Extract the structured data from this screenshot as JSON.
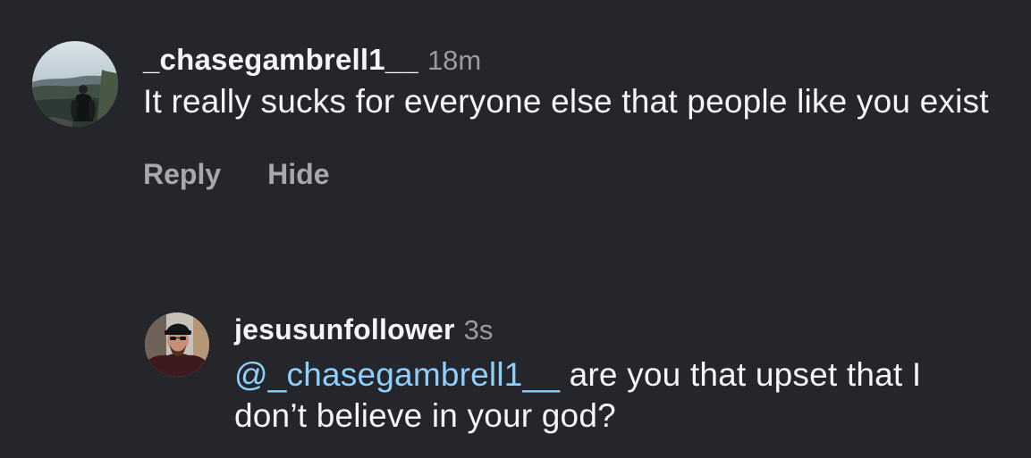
{
  "comment": {
    "username": "_chasegambrell1__",
    "timestamp": "18m",
    "text": "It really sucks for everyone else that people like you exist",
    "actions": {
      "reply_label": "Reply",
      "hide_label": "Hide"
    }
  },
  "reply": {
    "username": "jesusunfollower",
    "timestamp": "3s",
    "mention": "@_chasegambrell1__",
    "text": " are you that upset that I don’t believe in your god?"
  },
  "colors": {
    "background": "#25262b",
    "text": "#f5f5f7",
    "muted": "#9a9ba1",
    "mention": "#8fcffb"
  }
}
